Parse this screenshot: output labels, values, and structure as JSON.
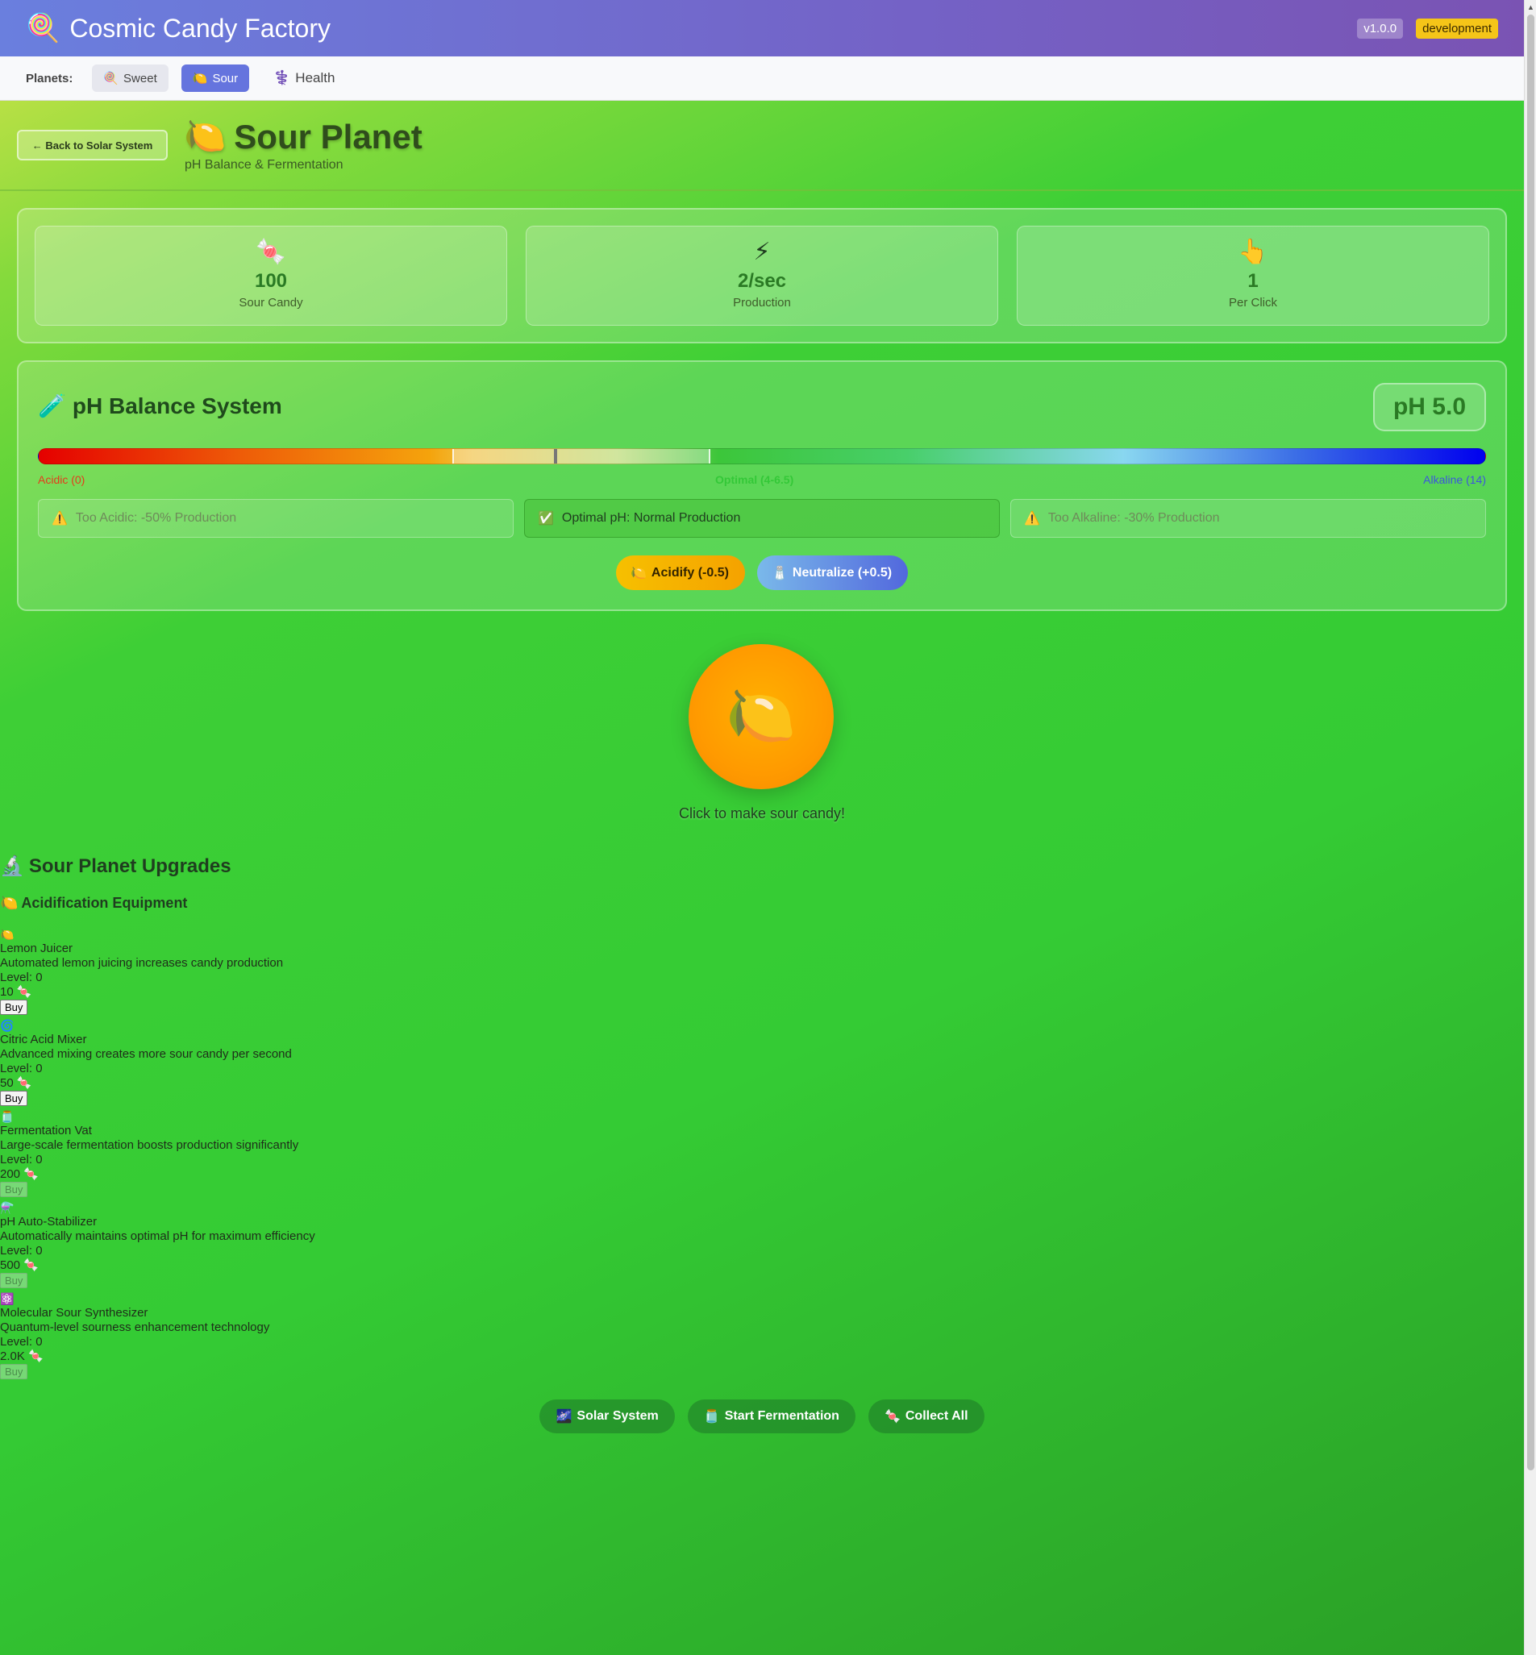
{
  "header": {
    "title": "Cosmic Candy Factory",
    "icon": "🍭",
    "version": "v1.0.0",
    "environment": "development"
  },
  "planet_nav": {
    "label": "Planets:",
    "items": [
      {
        "icon": "🍭",
        "label": "Sweet"
      },
      {
        "icon": "🍋",
        "label": "Sour"
      },
      {
        "icon": "⚕️",
        "label": "Health"
      }
    ],
    "active": "Sour"
  },
  "page": {
    "back_label": "← Back to Solar System",
    "title_icon": "🍋",
    "title": "Sour Planet",
    "subtitle": "pH Balance & Fermentation"
  },
  "stats": [
    {
      "icon": "🍬",
      "value": "100",
      "label": "Sour Candy"
    },
    {
      "icon": "⚡",
      "value": "2/sec",
      "label": "Production"
    },
    {
      "icon": "👆",
      "value": "1",
      "label": "Per Click"
    }
  ],
  "ph": {
    "title_icon": "🧪",
    "title": "pH Balance System",
    "reading": "pH 5.0",
    "value": 5.0,
    "scale_min": 0,
    "scale_max": 14,
    "optimal_min": 4,
    "optimal_max": 6.5,
    "scale_left": "Acidic (0)",
    "scale_mid": "Optimal (4-6.5)",
    "scale_right": "Alkaline (14)",
    "states": [
      {
        "icon": "⚠️",
        "text": "Too Acidic: -50% Production",
        "active": false
      },
      {
        "icon": "✅",
        "text": "Optimal pH: Normal Production",
        "active": true
      },
      {
        "icon": "⚠️",
        "text": "Too Alkaline: -30% Production",
        "active": false
      }
    ],
    "acidify_icon": "🍋",
    "acidify_label": "Acidify (-0.5)",
    "neutralize_icon": "🧂",
    "neutralize_label": "Neutralize (+0.5)"
  },
  "clicker": {
    "icon": "🍋",
    "caption": "Click to make sour candy!"
  },
  "upgrades": {
    "title_icon": "🔬",
    "title": "Sour Planet Upgrades",
    "section_icon": "🍋",
    "section": "Acidification Equipment",
    "items": [
      {
        "icon": "🍋",
        "name": "Lemon Juicer",
        "description": "Automated lemon juicing increases candy production",
        "level": "Level: 0",
        "cost": "10 🍬",
        "buy": "Buy",
        "affordable": true
      },
      {
        "icon": "🌀",
        "name": "Citric Acid Mixer",
        "description": "Advanced mixing creates more sour candy per second",
        "level": "Level: 0",
        "cost": "50 🍬",
        "buy": "Buy",
        "affordable": true
      },
      {
        "icon": "🫙",
        "name": "Fermentation Vat",
        "description": "Large-scale fermentation boosts production significantly",
        "level": "Level: 0",
        "cost": "200 🍬",
        "buy": "Buy",
        "affordable": false
      },
      {
        "icon": "⚗️",
        "name": "pH Auto-Stabilizer",
        "description": "Automatically maintains optimal pH for maximum efficiency",
        "level": "Level: 0",
        "cost": "500 🍬",
        "buy": "Buy",
        "affordable": false
      },
      {
        "icon": "⚛️",
        "name": "Molecular Sour Synthesizer",
        "description": "Quantum-level sourness enhancement technology",
        "level": "Level: 0",
        "cost": "2.0K 🍬",
        "buy": "Buy",
        "affordable": false
      }
    ]
  },
  "bottom_actions": [
    {
      "icon": "🌌",
      "label": "Solar System"
    },
    {
      "icon": "🫙",
      "label": "Start Fermentation"
    },
    {
      "icon": "🍬",
      "label": "Collect All"
    }
  ]
}
